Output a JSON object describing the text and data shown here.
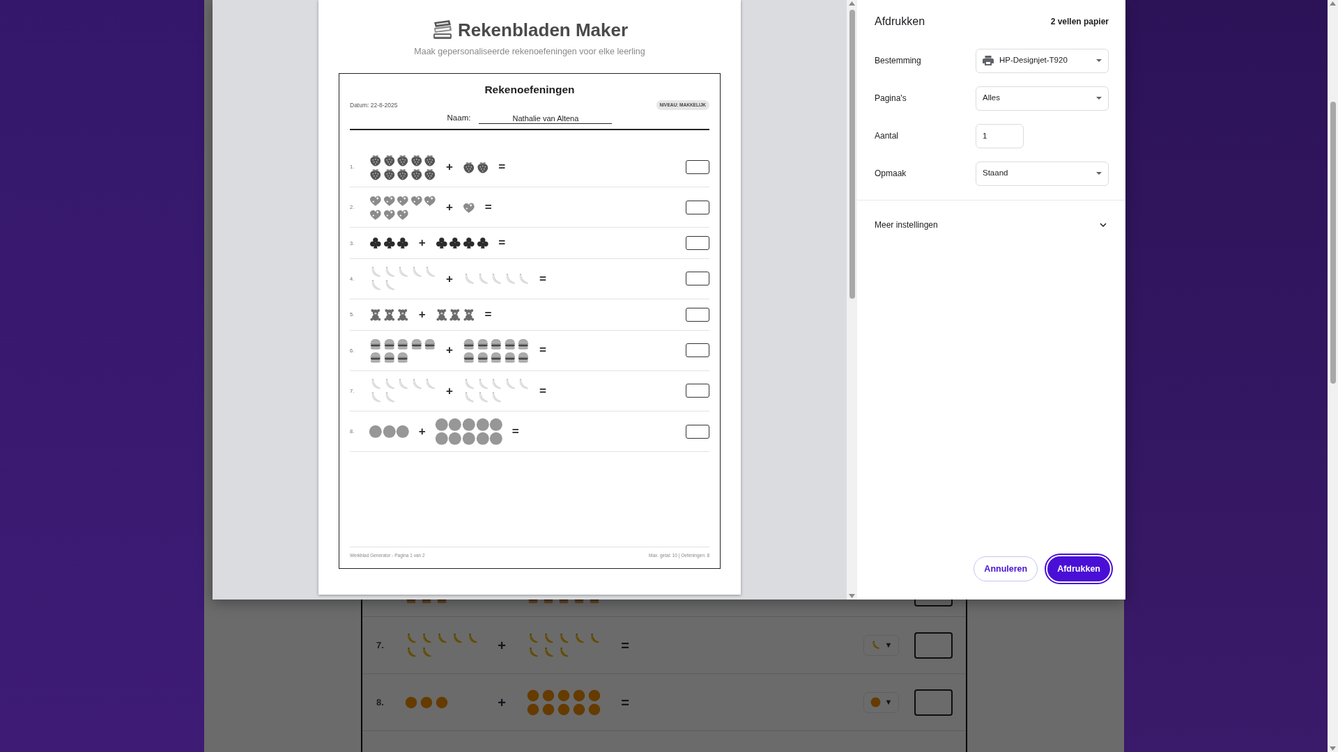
{
  "background_page": {
    "partial_row": {
      "left": [
        {
          "kind": "burger"
        },
        {
          "kind": "burger"
        },
        {
          "kind": "burger"
        }
      ],
      "right": [
        {
          "kind": "burger"
        },
        {
          "kind": "burger"
        },
        {
          "kind": "burger"
        },
        {
          "kind": "burger"
        },
        {
          "kind": "burger"
        }
      ]
    },
    "exercises": [
      {
        "number": "7.",
        "left": [
          {
            "kind": "banana"
          },
          {
            "kind": "banana"
          },
          {
            "kind": "banana"
          },
          {
            "kind": "banana"
          },
          {
            "kind": "banana"
          },
          {
            "kind": "banana"
          },
          {
            "kind": "banana"
          }
        ],
        "operator": "+",
        "right": [
          {
            "kind": "banana"
          },
          {
            "kind": "banana"
          },
          {
            "kind": "banana"
          },
          {
            "kind": "banana"
          },
          {
            "kind": "banana"
          },
          {
            "kind": "banana"
          },
          {
            "kind": "banana"
          },
          {
            "kind": "banana"
          }
        ],
        "equals": "=",
        "picker": {
          "kind": "banana",
          "caret": "▼"
        }
      },
      {
        "number": "8.",
        "left": [
          {
            "kind": "ball"
          },
          {
            "kind": "ball"
          },
          {
            "kind": "ball"
          }
        ],
        "operator": "+",
        "right": [
          {
            "kind": "ball"
          },
          {
            "kind": "ball"
          },
          {
            "kind": "ball"
          },
          {
            "kind": "ball"
          },
          {
            "kind": "ball"
          },
          {
            "kind": "ball"
          },
          {
            "kind": "ball"
          },
          {
            "kind": "ball"
          },
          {
            "kind": "ball"
          },
          {
            "kind": "ball"
          }
        ],
        "equals": "=",
        "picker": {
          "kind": "ball",
          "caret": "▼"
        }
      }
    ]
  },
  "print_dialog": {
    "preview": {
      "app_title": "Rekenbladen Maker",
      "app_subtitle": "Maak gepersonaliseerde rekenoefeningen voor elke leerling",
      "worksheet": {
        "title": "Rekenoefeningen",
        "date": "Datum: 22-8-2025",
        "level_badge": "NIVEAU: MAKKELIJK",
        "name_label": "Naam:",
        "name_value": "Nathalie van Altena",
        "exercises": [
          {
            "number": "1.",
            "left": [
              {
                "kind": "strawberry"
              },
              {
                "kind": "strawberry"
              },
              {
                "kind": "strawberry"
              },
              {
                "kind": "strawberry"
              },
              {
                "kind": "strawberry"
              },
              {
                "kind": "strawberry"
              },
              {
                "kind": "strawberry"
              },
              {
                "kind": "strawberry"
              },
              {
                "kind": "strawberry"
              },
              {
                "kind": "strawberry"
              }
            ],
            "operator": "+",
            "right": [
              {
                "kind": "strawberry"
              },
              {
                "kind": "strawberry"
              }
            ],
            "equals": "="
          },
          {
            "number": "2.",
            "left": [
              {
                "kind": "heart"
              },
              {
                "kind": "heart"
              },
              {
                "kind": "heart"
              },
              {
                "kind": "heart"
              },
              {
                "kind": "heart"
              },
              {
                "kind": "heart"
              },
              {
                "kind": "heart"
              },
              {
                "kind": "heart"
              }
            ],
            "operator": "+",
            "right": [
              {
                "kind": "heart"
              }
            ],
            "equals": "="
          },
          {
            "number": "3.",
            "left": [
              {
                "kind": "club"
              },
              {
                "kind": "club"
              },
              {
                "kind": "club"
              }
            ],
            "operator": "+",
            "right": [
              {
                "kind": "club"
              },
              {
                "kind": "club"
              },
              {
                "kind": "club"
              },
              {
                "kind": "club"
              }
            ],
            "equals": "="
          },
          {
            "number": "4.",
            "left": [
              {
                "kind": "banana"
              },
              {
                "kind": "banana"
              },
              {
                "kind": "banana"
              },
              {
                "kind": "banana"
              },
              {
                "kind": "banana"
              },
              {
                "kind": "banana"
              },
              {
                "kind": "banana"
              }
            ],
            "operator": "+",
            "right": [
              {
                "kind": "banana"
              },
              {
                "kind": "banana"
              },
              {
                "kind": "banana"
              },
              {
                "kind": "banana"
              },
              {
                "kind": "banana"
              }
            ],
            "equals": "="
          },
          {
            "number": "5.",
            "left": [
              {
                "kind": "bear"
              },
              {
                "kind": "bear"
              },
              {
                "kind": "bear"
              }
            ],
            "operator": "+",
            "right": [
              {
                "kind": "bear"
              },
              {
                "kind": "bear"
              },
              {
                "kind": "bear"
              }
            ],
            "equals": "="
          },
          {
            "number": "6.",
            "left": [
              {
                "kind": "burger"
              },
              {
                "kind": "burger"
              },
              {
                "kind": "burger"
              },
              {
                "kind": "burger"
              },
              {
                "kind": "burger"
              },
              {
                "kind": "burger"
              },
              {
                "kind": "burger"
              },
              {
                "kind": "burger"
              }
            ],
            "operator": "+",
            "right": [
              {
                "kind": "burger"
              },
              {
                "kind": "burger"
              },
              {
                "kind": "burger"
              },
              {
                "kind": "burger"
              },
              {
                "kind": "burger"
              },
              {
                "kind": "burger"
              },
              {
                "kind": "burger"
              },
              {
                "kind": "burger"
              },
              {
                "kind": "burger"
              },
              {
                "kind": "burger"
              }
            ],
            "equals": "="
          },
          {
            "number": "7.",
            "left": [
              {
                "kind": "banana"
              },
              {
                "kind": "banana"
              },
              {
                "kind": "banana"
              },
              {
                "kind": "banana"
              },
              {
                "kind": "banana"
              },
              {
                "kind": "banana"
              },
              {
                "kind": "banana"
              }
            ],
            "operator": "+",
            "right": [
              {
                "kind": "banana"
              },
              {
                "kind": "banana"
              },
              {
                "kind": "banana"
              },
              {
                "kind": "banana"
              },
              {
                "kind": "banana"
              },
              {
                "kind": "banana"
              },
              {
                "kind": "banana"
              },
              {
                "kind": "banana"
              }
            ],
            "equals": "="
          },
          {
            "number": "8.",
            "left": [
              {
                "kind": "ball"
              },
              {
                "kind": "ball"
              },
              {
                "kind": "ball"
              }
            ],
            "operator": "+",
            "right": [
              {
                "kind": "ball"
              },
              {
                "kind": "ball"
              },
              {
                "kind": "ball"
              },
              {
                "kind": "ball"
              },
              {
                "kind": "ball"
              },
              {
                "kind": "ball"
              },
              {
                "kind": "ball"
              },
              {
                "kind": "ball"
              },
              {
                "kind": "ball"
              },
              {
                "kind": "ball"
              }
            ],
            "equals": "="
          }
        ],
        "footer_left": "Werkblad Generator - Pagina 1 van 2",
        "footer_right": "Max. getal: 10 | Oefeningen: 8"
      }
    },
    "settings": {
      "title": "Afdrukken",
      "sheet_count": "2 vellen papier",
      "fields": [
        {
          "kind": "device-select",
          "label": "Bestemming",
          "value": "HP-Designjet-T920"
        },
        {
          "kind": "select",
          "label": "Pagina's",
          "value": "Alles"
        },
        {
          "kind": "number",
          "label": "Aantal",
          "value": "1"
        },
        {
          "kind": "select",
          "label": "Opmaak",
          "value": "Staand"
        }
      ],
      "more_settings": {
        "label": "Meer instellingen",
        "expanded": false
      },
      "buttons": [
        {
          "label": "Annuleren",
          "kind": "secondary"
        },
        {
          "label": "Afdrukken",
          "kind": "primary"
        }
      ]
    }
  }
}
